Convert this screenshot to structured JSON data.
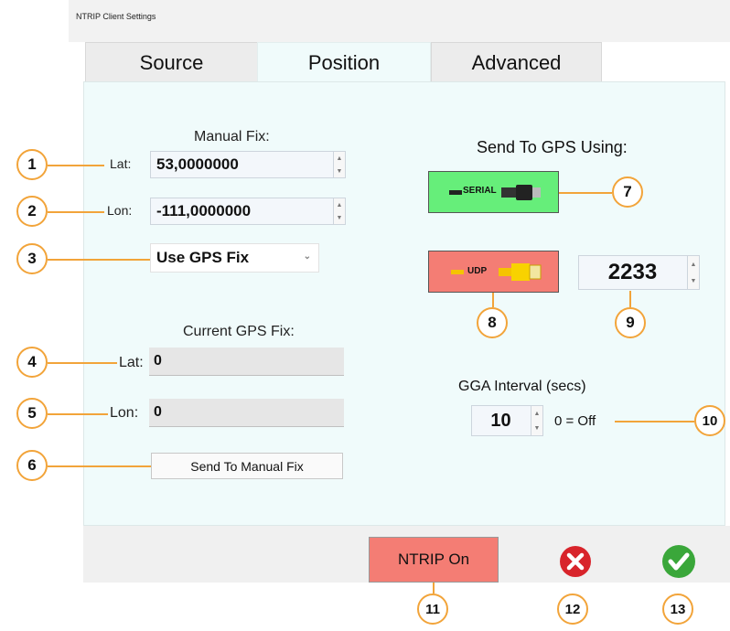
{
  "window": {
    "title": "NTRIP Client Settings"
  },
  "tabs": [
    {
      "label": "Source",
      "active": false
    },
    {
      "label": "Position",
      "active": true
    },
    {
      "label": "Advanced",
      "active": false
    }
  ],
  "manual_fix": {
    "heading": "Manual Fix:",
    "lat_label": "Lat:",
    "lat_value": "53,0000000",
    "lon_label": "Lon:",
    "lon_value": "-111,0000000",
    "mode_selected": "Use GPS Fix"
  },
  "current_fix": {
    "heading": "Current GPS Fix:",
    "lat_label": "Lat:",
    "lat_value": "0",
    "lon_label": "Lon:",
    "lon_value": "0",
    "send_button": "Send To Manual Fix"
  },
  "send_to_gps": {
    "heading": "Send To GPS Using:",
    "serial_label": "SERIAL",
    "udp_label": "UDP",
    "serial_color": "#66ee7a",
    "udp_color": "#f47d74",
    "udp_port": "2233"
  },
  "gga": {
    "heading": "GGA Interval (secs)",
    "value": "10",
    "off_note": "0 = Off"
  },
  "bottom": {
    "ntrip_button": "NTRIP On",
    "ntrip_color": "#f47d74",
    "cancel_color": "#d8242b",
    "ok_color": "#3aa73a"
  },
  "callouts": [
    "1",
    "2",
    "3",
    "4",
    "5",
    "6",
    "7",
    "8",
    "9",
    "10",
    "11",
    "12",
    "13"
  ]
}
